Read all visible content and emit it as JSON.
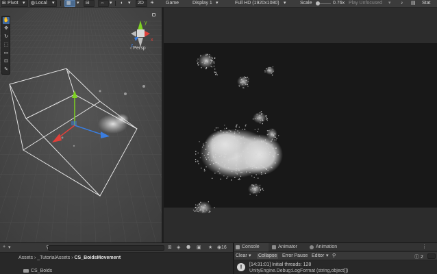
{
  "toolbar": {
    "pivot_label": "Pivot",
    "space_label": "Local",
    "twod_label": "2D",
    "game_tab_label": "Game",
    "display_label": "Display 1",
    "resolution_label": "Full HD (1920x1080)",
    "scale_label": "Scale",
    "scale_value": "0.76x",
    "play_focus_label": "Play Unfocused",
    "stats_label": "Stat"
  },
  "scene": {
    "projection_label": "Persp",
    "gizmo_axes": {
      "x": "x",
      "y": "y",
      "z": "z"
    }
  },
  "project": {
    "count_label": "16",
    "breadcrumb": [
      "Assets",
      "_TutorialAssets",
      "CS_BoidsMovement"
    ],
    "items": [
      "CS_Boids"
    ]
  },
  "console": {
    "tabs": [
      {
        "label": "Console",
        "icon": "console-icon"
      },
      {
        "label": "Animator",
        "icon": "animator-icon"
      },
      {
        "label": "Animation",
        "icon": "animation-icon"
      }
    ],
    "toolbar": {
      "clear_label": "Clear",
      "collapse_label": "Collapse",
      "error_pause_label": "Error Pause",
      "editor_label": "Editor",
      "count_label": "2"
    },
    "log": {
      "line1": "[14:31:01] Initial threads: 128",
      "line2": "UnityEngine.Debug:LogFormat (string,object[])"
    }
  },
  "colors": {
    "accent": "#3f6aa0",
    "axis_x": "#e0403a",
    "axis_y": "#7ed321",
    "axis_z": "#3a7de0"
  }
}
